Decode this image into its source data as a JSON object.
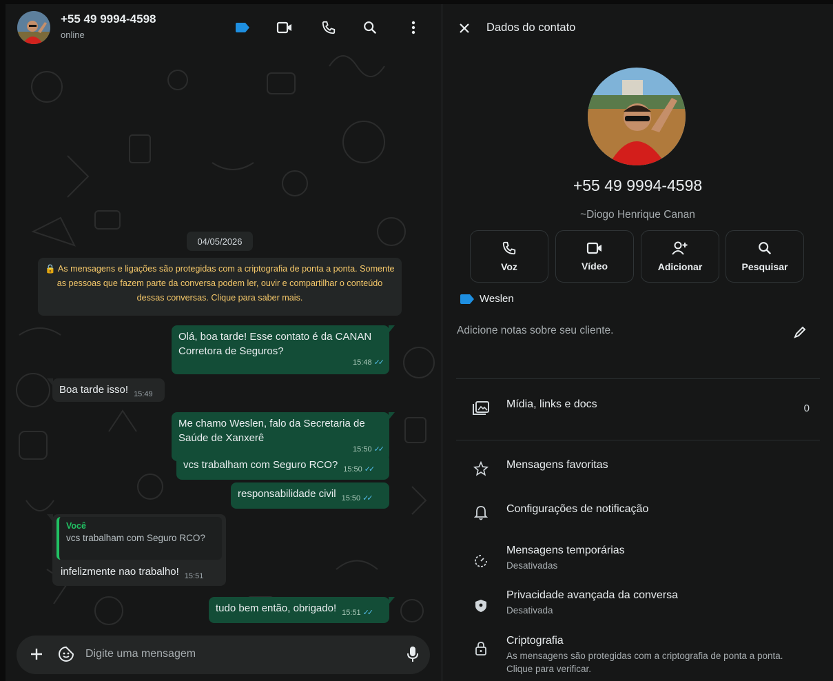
{
  "chat": {
    "contact_title": "+55 49 9994-4598",
    "status": "online",
    "date_divider": "04/05/2026",
    "encryption_notice": "🔒 As mensagens e ligações são protegidas com a criptografia de ponta a ponta. Somente as pessoas que fazem parte da conversa podem ler, ouvir e compartilhar o conteúdo dessas conversas. Clique para saber mais.",
    "messages": [
      {
        "dir": "out",
        "text": "Olá, boa tarde! Esse contato é da CANAN Corretora de Seguros?",
        "time": "15:48",
        "ticks": "✓✓"
      },
      {
        "dir": "in",
        "text": "Boa tarde isso!",
        "time": "15:49"
      },
      {
        "dir": "out",
        "text": "Me chamo Weslen, falo da Secretaria de Saúde de Xanxerê",
        "time": "15:50",
        "ticks": "✓✓"
      },
      {
        "dir": "out",
        "text": "vcs trabalham com Seguro RCO?",
        "time": "15:50",
        "ticks": "✓✓"
      },
      {
        "dir": "out",
        "text": "responsabilidade civil",
        "time": "15:50",
        "ticks": "✓✓"
      },
      {
        "dir": "in",
        "text": "infelizmente nao trabalho!",
        "time": "15:51",
        "quote": {
          "author": "Você",
          "text": "vcs trabalham com Seguro RCO?"
        }
      },
      {
        "dir": "out",
        "text": "tudo bem então, obrigado!",
        "time": "15:51",
        "ticks": "✓✓"
      }
    ],
    "composer_placeholder": "Digite uma mensagem"
  },
  "info": {
    "title": "Dados do contato",
    "phone": "+55 49 9994-4598",
    "name": "~Diogo Henrique Canan",
    "actions": [
      {
        "label": "Voz",
        "icon": "phone-icon"
      },
      {
        "label": "Vídeo",
        "icon": "video-icon"
      },
      {
        "label": "Adicionar",
        "icon": "add-user-icon"
      },
      {
        "label": "Pesquisar",
        "icon": "search-icon"
      }
    ],
    "tag": "Weslen",
    "notes_placeholder": "Adicione notas sobre seu cliente.",
    "media": {
      "label": "Mídia, links e docs",
      "count": "0"
    },
    "starred": "Mensagens favoritas",
    "notifications": "Configurações de notificação",
    "disappearing": {
      "title": "Mensagens temporárias",
      "sub": "Desativadas"
    },
    "privacy": {
      "title": "Privacidade avançada da conversa",
      "sub": "Desativada"
    },
    "encryption": {
      "title": "Criptografia",
      "sub": "As mensagens são protegidas com a criptografia de ponta a ponta. Clique para verificar."
    }
  },
  "colors": {
    "outgoing_bubble": "#134d37",
    "incoming_bubble": "#242626",
    "label_tag": "#1e8fe1",
    "read_ticks": "#53bdeb",
    "encryption_text": "#f5c86a",
    "quote_accent": "#21c063"
  }
}
